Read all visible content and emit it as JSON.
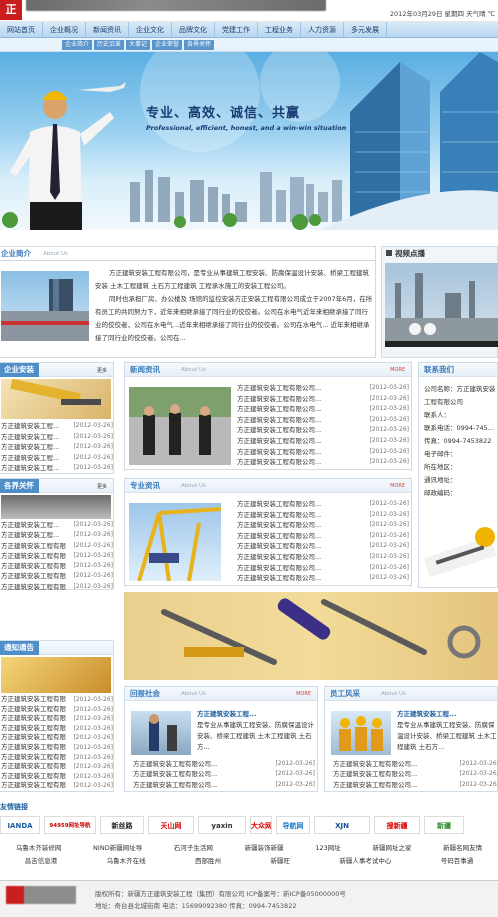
{
  "header": {
    "date": "2012年03月29日 星期四 天气晴 ℃",
    "logo_char": "正"
  },
  "nav": [
    "网站首页",
    "企业概况",
    "新闻资讯",
    "企业文化",
    "品牌文化",
    "党建工作",
    "工程业务",
    "人力资源",
    "多元发展"
  ],
  "subnav": [
    "企业简介",
    "历史沿革",
    "大事记",
    "企业荣誉",
    "各界关怀"
  ],
  "banner": {
    "slogan": "专业、高效、诚信、共赢",
    "slogan_en": "Professional, efficient, honest, and a win-win situation"
  },
  "intro": {
    "title": "企业简介",
    "sub": "About Us",
    "p1": "方正建筑安装工程有限公司，是专业从事建筑工程安装、防腐保温设计安装、桥梁工程建筑安装 土木工程建筑 土石方工程建筑 工程承水施工的安装工程公司。",
    "p2": "同时也承担厂房、办公楼及 场馆的监控安装方正安装工程有限公司成立于2007年6月，在所有员工的共同努力下，近年来相继承接了同行业的佼佼者。公司在水电气近年来相继承接了同行业的佼佼者，公司在水电气...近年来相继承接了同行业的佼佼者。公司在水电气... 近年来相继承接了同行业的佼佼者。公司在..."
  },
  "video": {
    "title": "视频点播"
  },
  "anzhuang": {
    "title": "企业安装",
    "more": "更多",
    "items": [
      "方正建筑安装工程...",
      "方正建筑安装工程...",
      "方正建筑安装工程...",
      "方正建筑安装工程...",
      "方正建筑安装工程..."
    ],
    "date": "[2012-03-26]"
  },
  "news": {
    "title": "新闻资讯",
    "sub": "About Us",
    "more": "MORE",
    "items": [
      "方正建筑安装工程有限公司...",
      "方正建筑安装工程有限公司...",
      "方正建筑安装工程有限公司...",
      "方正建筑安装工程有限公司...",
      "方正建筑安装工程有限公司...",
      "方正建筑安装工程有限公司...",
      "方正建筑安装工程有限公司...",
      "方正建筑安装工程有限公司..."
    ],
    "date": "[2012-03-26]"
  },
  "contact": {
    "title": "联系我们",
    "company": "公司名称：方正建筑安装工程有限公司",
    "person": "联系人：",
    "tel": "联系电话：0994-745...",
    "fax": "传真：0994-7453822",
    "email": "电子邮件：",
    "area": "所在地区：",
    "addr": "通讯地址：",
    "zip": "邮政编码："
  },
  "honor": {
    "title": "各界关怀",
    "more": "更多",
    "items": [
      "方正建筑安装工程...",
      "方正建筑安装工程...",
      "方正建筑安装工程有限",
      "方正建筑安装工程有限",
      "方正建筑安装工程有限",
      "方正建筑安装工程有限",
      "方正建筑安装工程有限"
    ],
    "date": "[2012-03-26]"
  },
  "pro": {
    "title": "专业资讯",
    "sub": "About Us",
    "more": "MORE",
    "items": [
      "方正建筑安装工程有限公司...",
      "方正建筑安装工程有限公司...",
      "方正建筑安装工程有限公司...",
      "方正建筑安装工程有限公司...",
      "方正建筑安装工程有限公司...",
      "方正建筑安装工程有限公司...",
      "方正建筑安装工程有限公司...",
      "方正建筑安装工程有限公司..."
    ],
    "date": "[2012-03-26]"
  },
  "notice": {
    "title": "通知通告",
    "items": [
      "方正建筑安装工程有限",
      "方正建筑安装工程有限",
      "方正建筑安装工程有限",
      "方正建筑安装工程有限",
      "方正建筑安装工程有限",
      "方正建筑安装工程有限",
      "方正建筑安装工程有限",
      "方正建筑安装工程有限",
      "方正建筑安装工程有限",
      "方正建筑安装工程有限"
    ],
    "date": "[2012-03-26]"
  },
  "society": {
    "title": "回报社会",
    "sub": "About Us",
    "more": "MORE",
    "headline": "方正建筑安装工程...",
    "desc": "是专业从事建筑工程安装、防腐保温设计安装、桥梁工程建筑 土木工程建筑 土石方...",
    "items": [
      "方正建筑安装工程有限公司...",
      "方正建筑安装工程有限公司...",
      "方正建筑安装工程有限公司..."
    ],
    "date": "[2012-03-26]"
  },
  "staff": {
    "title": "员工风采",
    "sub": "About Us",
    "more": "MORE",
    "headline": "方正建筑安装工程...",
    "desc": "是专业从事建筑工程安装、防腐保温设计安装、桥梁工程建筑 土木工程建筑 土石方...",
    "items": [
      "方正建筑安装工程有限公司...",
      "方正建筑安装工程有限公司...",
      "方正建筑安装工程有限公司..."
    ],
    "date": "[2012-03-26]"
  },
  "links": {
    "title": "友情链接",
    "logos": [
      "IANDA",
      "94959网址导航",
      "新丝路",
      "天山网",
      "yaxin",
      "大众网",
      "导航网",
      "XJN",
      "搜新疆",
      "新疆"
    ],
    "row1": [
      "乌鲁木齐装修网",
      "NIND新疆网址导",
      "石河子生活网",
      "新疆装饰新疆",
      "123网址",
      "新疆网址之家",
      "新疆名网友情"
    ],
    "row2": [
      "昌吉信息港",
      "乌鲁木齐在线",
      "西部胜州",
      "新疆旺",
      "新疆人事考试中心",
      "号码百事通"
    ]
  },
  "footer": {
    "copy": "版权所有：新疆方正建筑安装工程（集团）有限公司 ICP备案号：新ICP备05000000号",
    "addr": "地址：奇台县北城街南  电话：15699092380  传真：0994-7453822"
  }
}
